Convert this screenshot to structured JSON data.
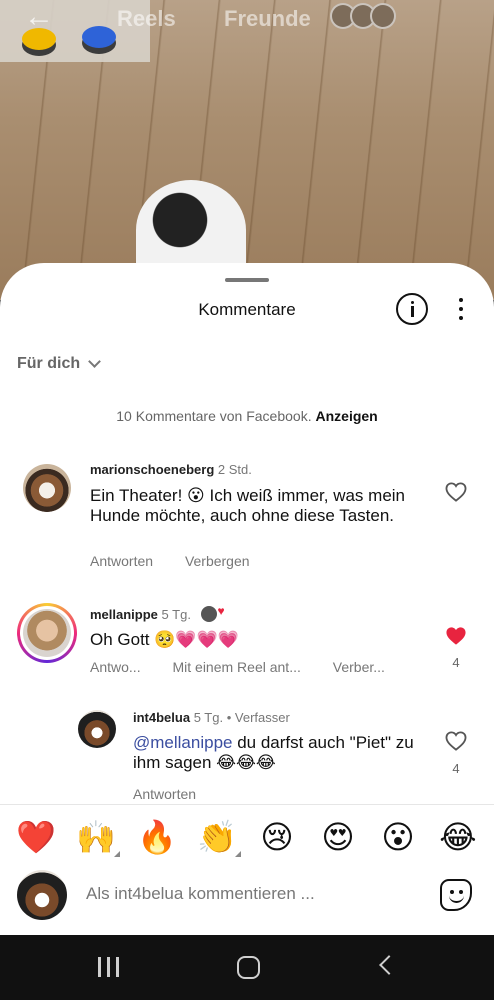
{
  "reel": {
    "tabs": {
      "reels": "Reels",
      "friends": "Freunde"
    }
  },
  "sheet": {
    "title": "Kommentare",
    "filter_label": "Für dich",
    "facebook_notice": "10 Kommentare von Facebook.",
    "facebook_action": "Anzeigen"
  },
  "comments": [
    {
      "username": "marionschoeneberg",
      "time": "2 Std.",
      "text": "Ein Theater! 😮 Ich weiß immer, was mein Hunde möchte, auch ohne diese Tasten.",
      "actions": [
        "Antworten",
        "Verbergen"
      ],
      "liked": false
    },
    {
      "username": "mellanippe",
      "time": "5 Tg.",
      "text": "Oh Gott 🥺💗💗💗",
      "actions": [
        "Antwo...",
        "Mit einem Reel ant...",
        "Verber..."
      ],
      "liked": true,
      "likes": "4"
    },
    {
      "username": "int4belua",
      "time": "5 Tg.",
      "badge": "Verfasser",
      "mention": "@mellanippe",
      "text": " du darfst auch \"Piet\" zu ihm sagen 😂😂😂",
      "actions": [
        "Antworten"
      ],
      "liked": false,
      "likes": "4"
    }
  ],
  "reactions": [
    "❤️",
    "🙌",
    "🔥",
    "👏",
    "😢",
    "😍",
    "😮",
    "😂"
  ],
  "compose": {
    "placeholder": "Als int4belua kommentieren ..."
  },
  "icons": {
    "back": "arrow-left-icon",
    "info": "info-icon",
    "more": "more-vertical-icon",
    "heart": "heart-icon",
    "sticker": "sticker-icon"
  },
  "colors": {
    "like_red": "#e8243f",
    "mention_blue": "#3b4ea0"
  }
}
